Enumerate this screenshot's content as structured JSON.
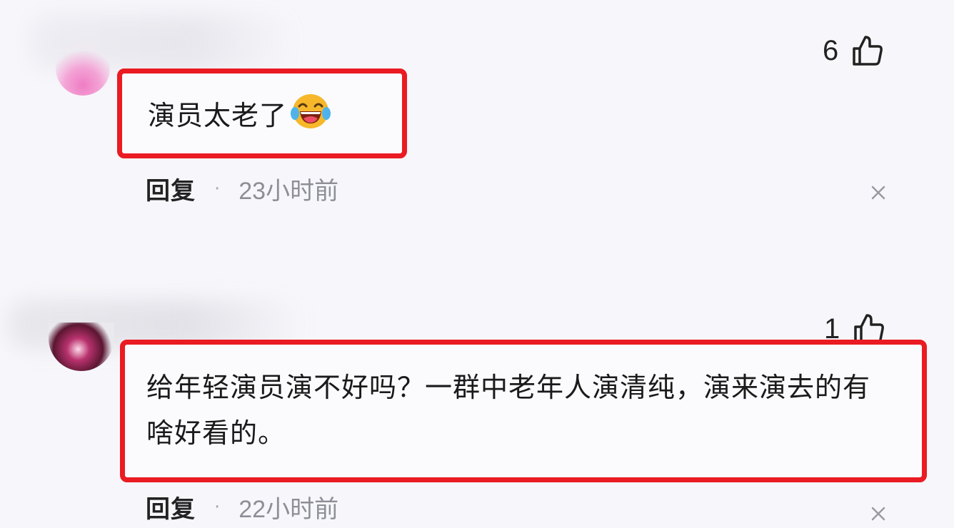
{
  "comments": [
    {
      "text": "演员太老了",
      "emoji": "laughing-tears-emoji",
      "like_count": "6",
      "reply_label": "回复",
      "separator": "·",
      "time": "23小时前"
    },
    {
      "text": "给年轻演员演不好吗？一群中老年人演清纯，演来演去的有啥好看的。",
      "like_count": "1",
      "reply_label": "回复",
      "separator": "·",
      "time": "22小时前"
    }
  ],
  "colors": {
    "highlight": "#ea1b22",
    "background": "#f7f7fb",
    "muted": "#8e8e96"
  }
}
